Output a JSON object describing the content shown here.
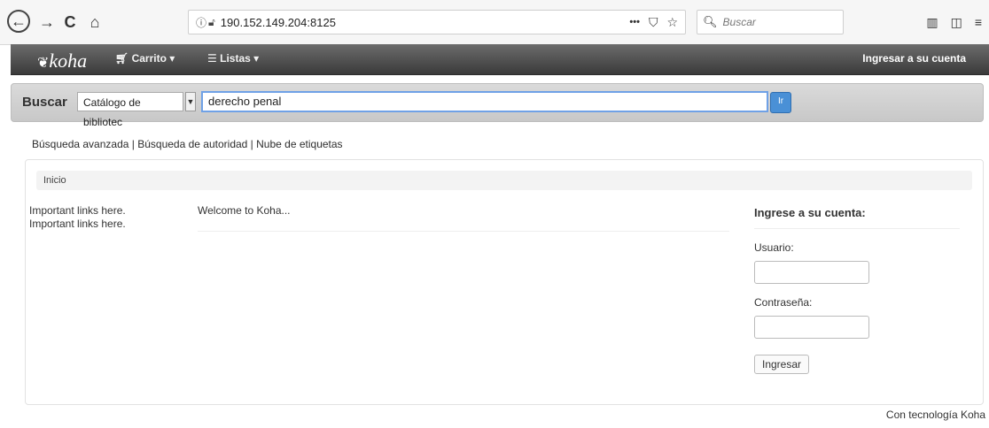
{
  "browser": {
    "back_glyph": "←",
    "forward_glyph": "→",
    "reload_glyph": "C",
    "home_glyph": "⌂",
    "url": "190.152.149.204:8125",
    "search_placeholder": "Buscar",
    "menu_dots": "•••"
  },
  "navbar": {
    "logo_text": "koha",
    "cart_label": "Carrito",
    "lists_label": "Listas",
    "login_link": "Ingresar a su cuenta"
  },
  "search": {
    "label": "Buscar",
    "catalog_select_value": "Catálogo de bibliotec",
    "query_value": "derecho penal",
    "go_label": "Ir"
  },
  "links": {
    "advanced": "Búsqueda avanzada",
    "authority": "Búsqueda de autoridad",
    "tag_cloud": "Nube de etiquetas",
    "separator": " | "
  },
  "breadcrumb": {
    "home": "Inicio"
  },
  "main": {
    "important_link_1": "Important links here.",
    "important_link_2": "Important links here.",
    "welcome": "Welcome to Koha..."
  },
  "login": {
    "heading": "Ingrese a su cuenta:",
    "user_label": "Usuario:",
    "password_label": "Contraseña:",
    "submit_label": "Ingresar"
  },
  "footer": {
    "powered_by": "Con tecnología Koha"
  }
}
